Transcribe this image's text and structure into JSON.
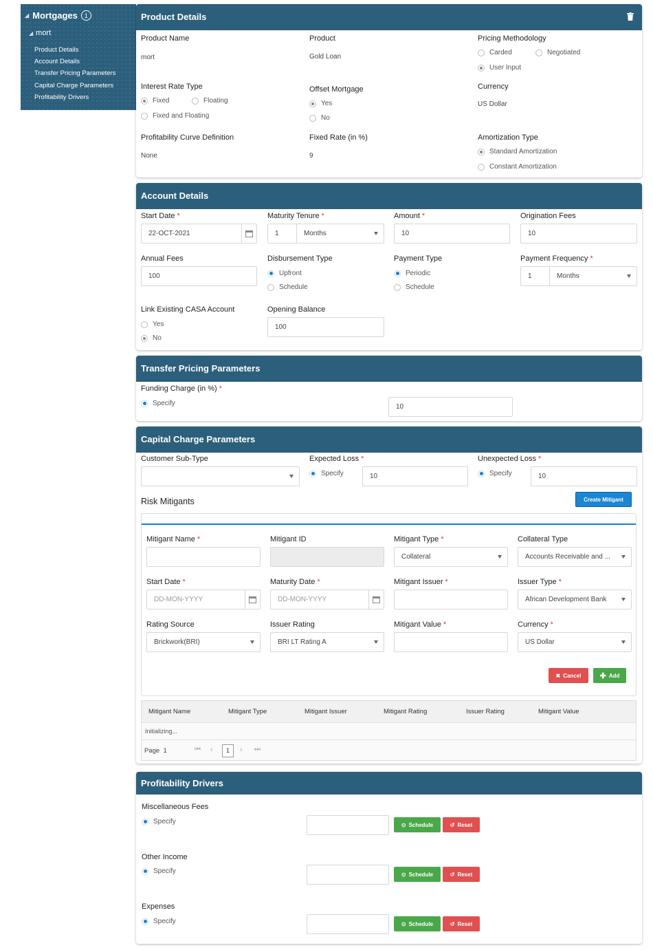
{
  "nav": {
    "title": "Mortgages",
    "badge": "1",
    "sub": "mort",
    "links": [
      "Product Details",
      "Account Details",
      "Transfer Pricing Parameters",
      "Capital Charge Parameters",
      "Profitability Drivers"
    ]
  },
  "product": {
    "header": "Product Details",
    "product_name_label": "Product Name",
    "product_name": "mort",
    "product_label": "Product",
    "product": "Gold Loan",
    "pricing_label": "Pricing Methodology",
    "pricing_options": [
      "Carded",
      "Negotiated",
      "User Input"
    ],
    "interest_label": "Interest Rate Type",
    "interest_options": [
      "Fixed",
      "Floating",
      "Fixed and Floating"
    ],
    "offset_label": "Offset Mortgage",
    "offset_options": [
      "Yes",
      "No"
    ],
    "currency_label": "Currency",
    "currency": "US Dollar",
    "curve_label": "Profitability Curve Definition",
    "curve": "None",
    "fixed_rate_label": "Fixed Rate (in %)",
    "fixed_rate": "9",
    "amort_label": "Amortization Type",
    "amort_options": [
      "Standard Amortization",
      "Constant Amortization"
    ]
  },
  "account": {
    "header": "Account Details",
    "start_date_label": "Start Date",
    "start_date": "22-OCT-2021",
    "tenure_label": "Maturity Tenure",
    "tenure_value": "1",
    "tenure_unit": "Months",
    "amount_label": "Amount",
    "amount": "10",
    "orig_label": "Origination Fees",
    "orig": "10",
    "annual_label": "Annual Fees",
    "annual": "100",
    "disb_label": "Disbursement Type",
    "disb_options": [
      "Upfront",
      "Schedule"
    ],
    "paytype_label": "Payment Type",
    "paytype_options": [
      "Periodic",
      "Schedule"
    ],
    "payfreq_label": "Payment Frequency",
    "payfreq_value": "1",
    "payfreq_unit": "Months",
    "casa_label": "Link Existing CASA Account",
    "casa_options": [
      "Yes",
      "No"
    ],
    "opening_label": "Opening Balance",
    "opening": "100"
  },
  "transfer": {
    "header": "Transfer Pricing Parameters",
    "funding_label": "Funding Charge (in %)",
    "specify": "Specify",
    "funding": "10"
  },
  "capital": {
    "header": "Capital Charge Parameters",
    "subtype_label": "Customer Sub-Type",
    "expected_label": "Expected Loss",
    "expected": "10",
    "unexpected_label": "Unexpected Loss",
    "unexpected": "10",
    "specify": "Specify",
    "risk_label": "Risk Mitigants",
    "create_btn": "Create Mitigant",
    "mit_name_label": "Mitigant Name",
    "mit_id_label": "Mitigant ID",
    "mit_type_label": "Mitigant Type",
    "mit_type": "Collateral",
    "coll_type_label": "Collateral Type",
    "coll_type": "Accounts Receivable and ...",
    "mit_start_label": "Start Date",
    "date_placeholder": "DD-MON-YYYY",
    "mit_maturity_label": "Maturity Date",
    "mit_issuer_label": "Mitigant Issuer",
    "issuer_type_label": "Issuer Type",
    "issuer_type": "African Development Bank",
    "rating_source_label": "Rating Source",
    "rating_source": "Brickwork(BRI)",
    "issuer_rating_label": "Issuer Rating",
    "issuer_rating": "BRI LT Rating A",
    "mit_value_label": "Mitigant Value",
    "mit_currency_label": "Currency",
    "mit_currency": "US Dollar",
    "cancel_btn": "Cancel",
    "add_btn": "Add",
    "grid_columns": [
      "Mitigant Name",
      "Mitigant Type",
      "Mitigant Issuer",
      "Mitigant Rating",
      "Issuer Rating",
      "Mitigant Value"
    ],
    "grid_status": "Initializing...",
    "page_label": "Page",
    "page_value": "1",
    "page_current": "1"
  },
  "profit": {
    "header": "Profitability Drivers",
    "specify": "Specify",
    "schedule_btn": "Schedule",
    "reset_btn": "Reset",
    "rows": [
      {
        "label": "Miscellaneous Fees"
      },
      {
        "label": "Other Income"
      },
      {
        "label": "Expenses"
      }
    ]
  }
}
